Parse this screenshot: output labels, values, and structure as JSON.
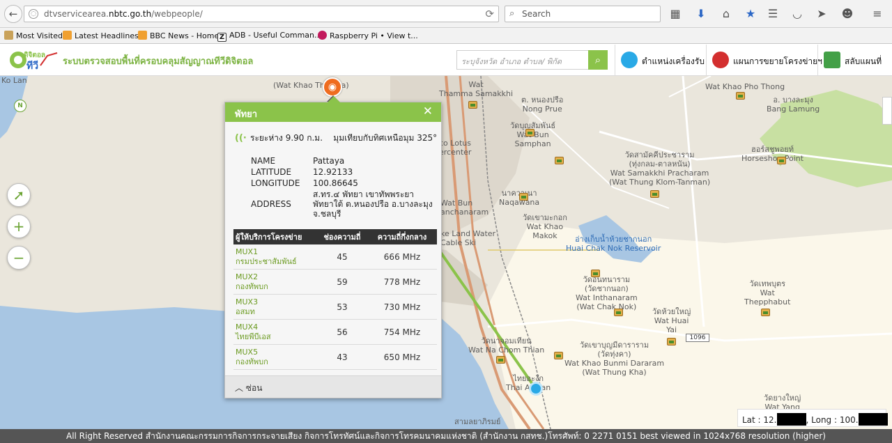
{
  "browser": {
    "url_prefix": "dtvservicearea.",
    "url_domain": "nbtc.go.th",
    "url_path": "/webpeople/",
    "search_placeholder": "Search"
  },
  "bookmarks": [
    {
      "label": "Most Visited",
      "icon": "bookmark-icon"
    },
    {
      "label": "Latest Headlines",
      "icon": "rss-icon"
    },
    {
      "label": "BBC News - Home",
      "icon": "rss-icon"
    },
    {
      "label": "ADB - Useful Comman...",
      "icon": "z-icon"
    },
    {
      "label": "Raspberry Pi • View t...",
      "icon": "raspberry-icon"
    }
  ],
  "header": {
    "logo_text": "ดิจิตอลทีวี",
    "site_title": "ระบบตรวจสอบพื้นที่ครอบคลุมสัญญาณทีวีดิจิตอล",
    "search_placeholder": "ระบุจังหวัด อำเภอ ตำบล/ พิกัด",
    "nav": [
      {
        "label": "ตำแหน่งเครื่องรับ",
        "icon": "location-pin-icon",
        "color": "#29a9e6"
      },
      {
        "label": "แผนการขยายโครงข่ายฯ",
        "icon": "broadcast-plan-icon",
        "color": "#d32f2f"
      },
      {
        "label": "สลับแผนที่",
        "icon": "switch-map-icon",
        "color": "#43a047"
      }
    ]
  },
  "map": {
    "labels": {
      "ko_lan": "Ko Lan",
      "wat_khao_tha_top": "Wat Khao Tha...",
      "wat_khao_tha": "(Wat Khao Tha...ya)",
      "wat_thamma": "Wat\nThamma Samakkhi",
      "nong_prue": "ต. หนองปรือ\nNong Prue",
      "wat_khao_pho": "Wat Khao Pho Thong",
      "bang_lamung": "อ. บางละมุง\nBang Lamung",
      "lotus": "co Lotus\nercenter",
      "wat_bun": "วัดบุญสัมพันธ์\nWat Bun\nSamphan",
      "samakkhi": "วัดสามัคคีประชาราม\n(ทุ่งกลม-ตาลหนัน)\nWat Samakkhi Pracharam\n(Wat Thung Klom-Tanman)",
      "horseshoe": "ฮอร์สชูพอยท์\nHorseshoe Point",
      "wat_bun_nan": "Wat Bun\nanchanaram",
      "naqawana": "นาควาเนา\nNaqawana",
      "khao_makok": "วัดเขามะกอก\nWat Khao\nMakok",
      "lake_lw": "ke Land Water\nCable Ski",
      "reservoir": "อ่างเก็บน้ำห้วยชากนอก\nHuai Chak Nok Reservoir",
      "inthanaram": "วัดอินทนาราม\n(วัดชากนอก)\nWat Inthanaram\n(Wat Chak Nok)",
      "thepphabut": "วัดเทพบุตร\nWat\nThepphabut",
      "huai_yai": "วัดห้วยใหญ่\nWat Huai\nYai",
      "na_chom_thian": "วัดนาจอมเทียน\nWat Na Chom Thian",
      "bunmi": "วัดเขาบุญมีดาราราม\n(วัดทุ่งคา)\nWat Khao Bunmi Dararam\n(Wat Thung Kha)",
      "thai_aa": "ไทยอะงัก\nThai Alakan",
      "wat_yang": "วัดยางใหญ่\nWat Yang",
      "sathanu": "สามลยาภิรมย์",
      "route": "1096"
    },
    "tower_icon": "broadcast-tower-icon",
    "controls": {
      "locate": "locate-arrow-icon",
      "zoom_in": "+",
      "zoom_out": "−",
      "compass": "N"
    },
    "lat_label": "Lat : 12.",
    "long_label": ", Long : 100."
  },
  "popup": {
    "title": "พัทยา",
    "close": "✕",
    "distance": "ระยะห่าง 9.90 ก.ม.",
    "bearing": "มุมเทียบกับทิศเหนือมุม 325°",
    "fields": {
      "name_label": "NAME",
      "name_value": "Pattaya",
      "lat_label": "LATITUDE",
      "lat_value": "12.92133",
      "long_label": "LONGITUDE",
      "long_value": "100.86645",
      "address_label": "ADDRESS",
      "address_value": "ส.ทร.๔ พัทยา เขาทัพพระยา พัทยาใต้ ต.หนองปรือ อ.บางละมุง จ.ชลบุรี"
    },
    "table": {
      "headers": [
        "ผู้ให้บริการโครงข่าย",
        "ช่องความถี่",
        "ความถี่กึ่งกลาง"
      ],
      "rows": [
        {
          "mux": "MUX1",
          "provider": "กรมประชาสัมพันธ์",
          "channel": "45",
          "freq": "666 MHz"
        },
        {
          "mux": "MUX2",
          "provider": "กองทัพบก",
          "channel": "59",
          "freq": "778 MHz"
        },
        {
          "mux": "MUX3",
          "provider": "อสมท",
          "channel": "53",
          "freq": "730 MHz"
        },
        {
          "mux": "MUX4",
          "provider": "ไทยพีบีเอส",
          "channel": "56",
          "freq": "754 MHz"
        },
        {
          "mux": "MUX5",
          "provider": "กองทัพบก",
          "channel": "43",
          "freq": "650 MHz"
        }
      ]
    },
    "hide_label": "ซ่อน"
  },
  "footer": {
    "text": "All Right Reserved สำนักงานคณะกรรมการกิจการกระจายเสียง กิจการโทรทัศน์และกิจการโทรคมนาคมแห่งชาติ (สำนักงาน กสทช.)โทรศัพท์: 0 2271 0151 best viewed in 1024x768 resolution (higher)"
  }
}
